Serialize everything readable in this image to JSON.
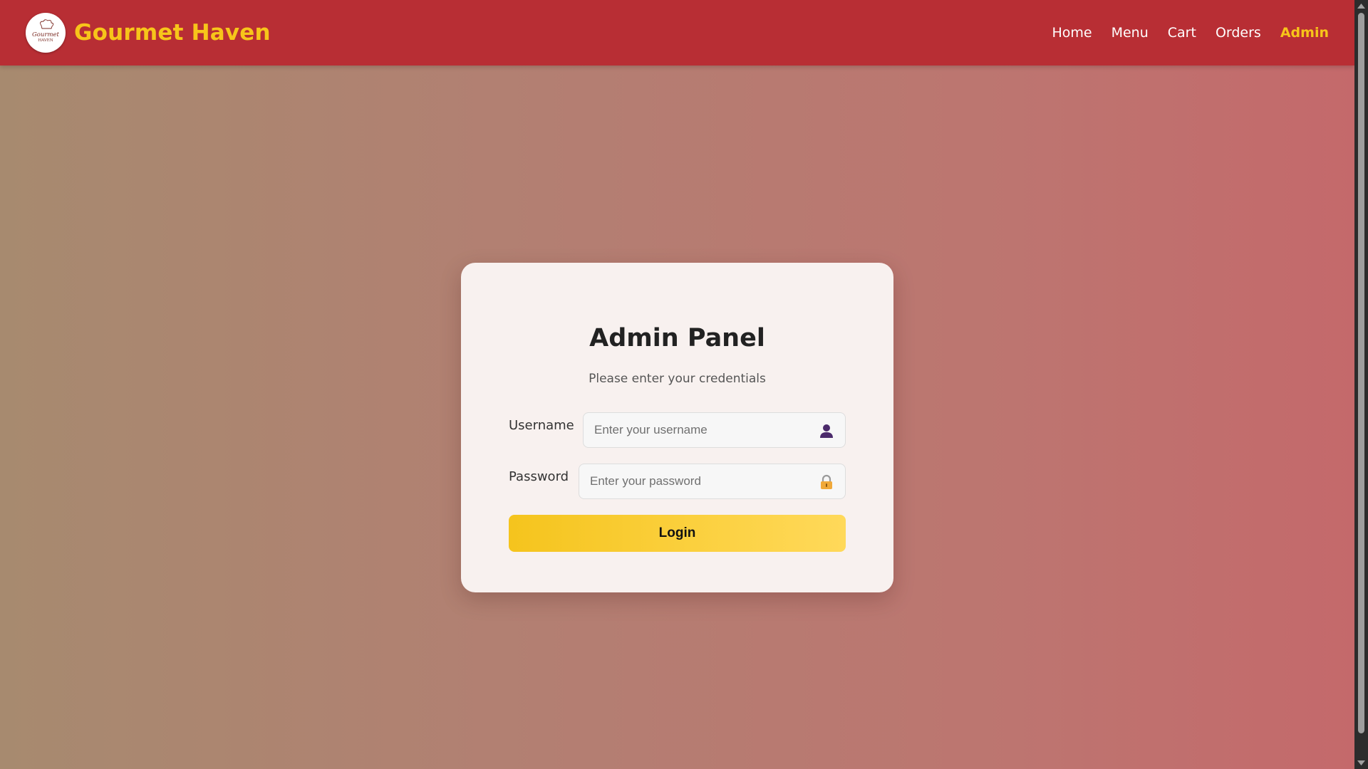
{
  "header": {
    "brand_name": "Gourmet Haven",
    "logo_text_line1": "Gourmet",
    "logo_text_line2": "HAVEN",
    "brand_color": "#f7c51a",
    "bar_color": "#b82e34",
    "nav": [
      {
        "label": "Home",
        "active": false
      },
      {
        "label": "Menu",
        "active": false
      },
      {
        "label": "Cart",
        "active": false
      },
      {
        "label": "Orders",
        "active": false
      },
      {
        "label": "Admin",
        "active": true
      }
    ]
  },
  "login": {
    "title": "Admin Panel",
    "subtitle": "Please enter your credentials",
    "username": {
      "label": "Username",
      "placeholder": "Enter your username",
      "value": "",
      "icon": "user-icon"
    },
    "password": {
      "label": "Password",
      "placeholder": "Enter your password",
      "value": "",
      "icon": "lock-icon"
    },
    "submit_label": "Login",
    "button_color": "#f5c41d"
  }
}
